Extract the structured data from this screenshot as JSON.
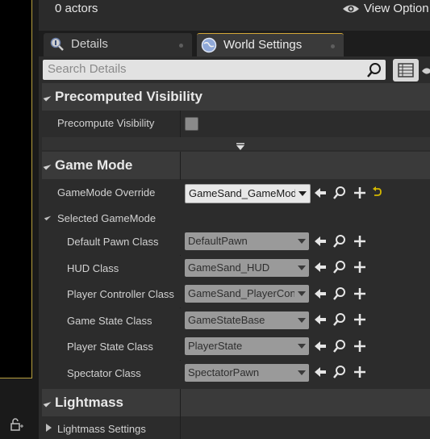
{
  "topbar": {
    "actors_label": "0 actors",
    "view_options_label": "View Option"
  },
  "tabs": [
    {
      "label": "Details",
      "icon": "details-icon"
    },
    {
      "label": "World Settings",
      "icon": "globe-icon"
    }
  ],
  "search": {
    "placeholder": "Search Details",
    "value": ""
  },
  "sections": {
    "precomputed": {
      "title": "Precomputed Visibility",
      "precompute_label": "Precompute Visibility",
      "precompute_checked": false
    },
    "gamemode": {
      "title": "Game Mode",
      "override_label": "GameMode Override",
      "override_value": "GameSand_GameMode",
      "selected_label": "Selected GameMode",
      "rows": [
        {
          "label": "Default Pawn Class",
          "value": "DefaultPawn"
        },
        {
          "label": "HUD Class",
          "value": "GameSand_HUD"
        },
        {
          "label": "Player Controller Class",
          "value": "GameSand_PlayerController"
        },
        {
          "label": "Game State Class",
          "value": "GameStateBase"
        },
        {
          "label": "Player State Class",
          "value": "PlayerState"
        },
        {
          "label": "Spectator Class",
          "value": "SpectatorPawn"
        }
      ]
    },
    "lightmass": {
      "title": "Lightmass",
      "settings_label": "Lightmass Settings"
    }
  },
  "colors": {
    "accent": "#d4a838",
    "reset_arrow": "#d4b800",
    "background": "#2c2c2c"
  }
}
